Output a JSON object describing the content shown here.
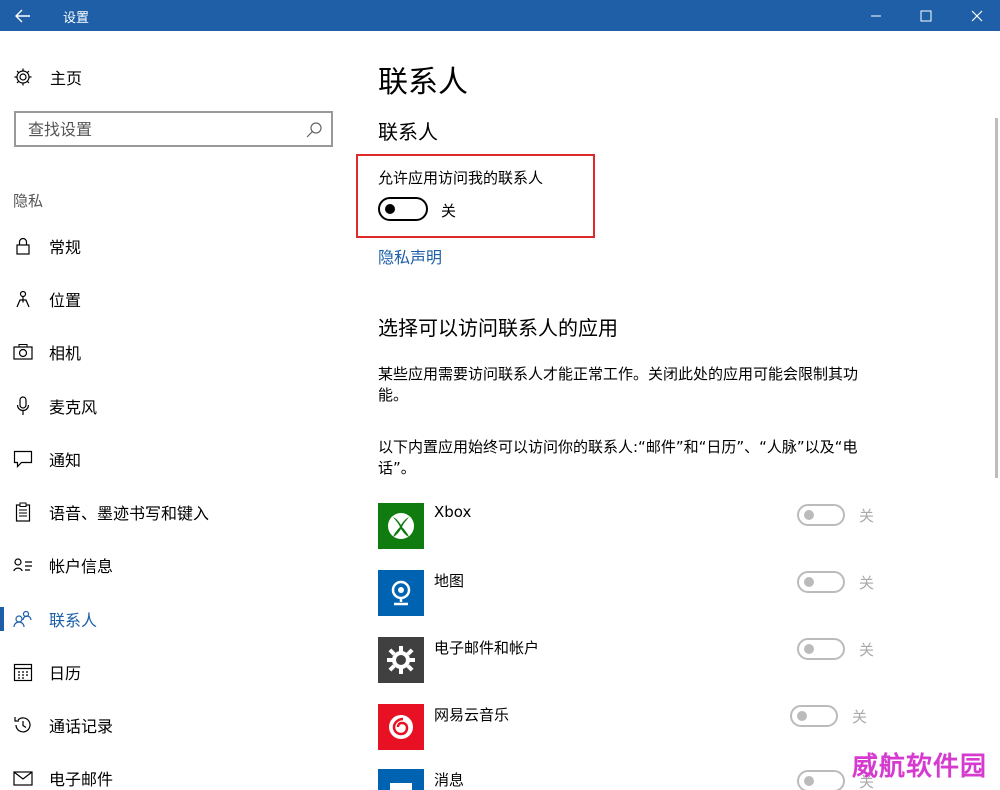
{
  "window": {
    "title": "设置"
  },
  "sidebar": {
    "home_label": "主页",
    "search_placeholder": "查找设置",
    "section_label": "隐私",
    "items": [
      {
        "label": "常规",
        "icon": "lock-icon"
      },
      {
        "label": "位置",
        "icon": "location-icon"
      },
      {
        "label": "相机",
        "icon": "camera-icon"
      },
      {
        "label": "麦克风",
        "icon": "microphone-icon"
      },
      {
        "label": "通知",
        "icon": "notification-icon"
      },
      {
        "label": "语音、墨迹书写和键入",
        "icon": "clipboard-icon"
      },
      {
        "label": "帐户信息",
        "icon": "account-info-icon"
      },
      {
        "label": "联系人",
        "icon": "contacts-icon",
        "active": true
      },
      {
        "label": "日历",
        "icon": "calendar-icon"
      },
      {
        "label": "通话记录",
        "icon": "call-history-icon"
      },
      {
        "label": "电子邮件",
        "icon": "mail-icon"
      }
    ]
  },
  "main": {
    "title": "联系人",
    "subtitle": "联系人",
    "allow_label": "允许应用访问我的联系人",
    "allow_state": "关",
    "privacy_link": "隐私声明",
    "choose_title": "选择可以访问联系人的应用",
    "desc1": "某些应用需要访问联系人才能正常工作。关闭此处的应用可能会限制其功能。",
    "desc2": "以下内置应用始终可以访问你的联系人:“邮件”和“日历”、“人脉”以及“电话”。",
    "apps": [
      {
        "name": "Xbox",
        "state": "关",
        "color": "#107c10",
        "icon": "xbox-icon"
      },
      {
        "name": "地图",
        "state": "关",
        "color": "#0063b1",
        "icon": "maps-icon"
      },
      {
        "name": "电子邮件和帐户",
        "state": "关",
        "color": "#404040",
        "icon": "settings-gear-icon"
      },
      {
        "name": "网易云音乐",
        "state": "关",
        "color": "#e81123",
        "icon": "netease-music-icon"
      },
      {
        "name": "消息",
        "state": "关",
        "color": "#0063b1",
        "icon": "messaging-icon"
      }
    ]
  },
  "watermark": "威航软件园"
}
